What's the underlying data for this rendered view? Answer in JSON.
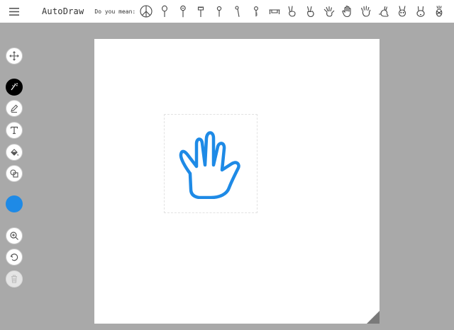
{
  "header": {
    "menu_icon": "hamburger-menu-icon",
    "app_title": "AutoDraw",
    "suggestion_label": "Do you mean:",
    "suggestions": [
      {
        "icon": "peace-sign-icon"
      },
      {
        "icon": "balloon-icon"
      },
      {
        "icon": "lollipop-icon"
      },
      {
        "icon": "ice-cream-icon"
      },
      {
        "icon": "push-pin-icon"
      },
      {
        "icon": "match-stick-icon"
      },
      {
        "icon": "key-icon"
      },
      {
        "icon": "bench-icon"
      },
      {
        "icon": "peace-hand-icon"
      },
      {
        "icon": "victory-hand-icon"
      },
      {
        "icon": "spread-hand-icon"
      },
      {
        "icon": "open-palm-icon"
      },
      {
        "icon": "raised-hand-icon"
      },
      {
        "icon": "rabbit-icon"
      },
      {
        "icon": "bunny-icon"
      },
      {
        "icon": "rabbit-face-icon"
      },
      {
        "icon": "pineapple-icon"
      }
    ]
  },
  "toolbar": {
    "tools": [
      {
        "icon": "move-arrows-icon"
      },
      {
        "icon": "autodraw-icon",
        "active": true
      },
      {
        "icon": "pencil-icon"
      },
      {
        "icon": "text-icon"
      },
      {
        "icon": "fill-bucket-icon"
      },
      {
        "icon": "shapes-icon"
      },
      {
        "icon": "zoom-icon"
      },
      {
        "icon": "undo-icon"
      },
      {
        "icon": "delete-icon",
        "disabled": true
      }
    ],
    "selected_color": "#1e8ae6"
  },
  "canvas": {
    "background": "#ffffff",
    "stroke_color": "#1e8ae6",
    "drawing": "hand"
  },
  "colors": {
    "workspace": "#a9a9a9",
    "topbar": "#ffffff",
    "active_tool": "#000000"
  }
}
